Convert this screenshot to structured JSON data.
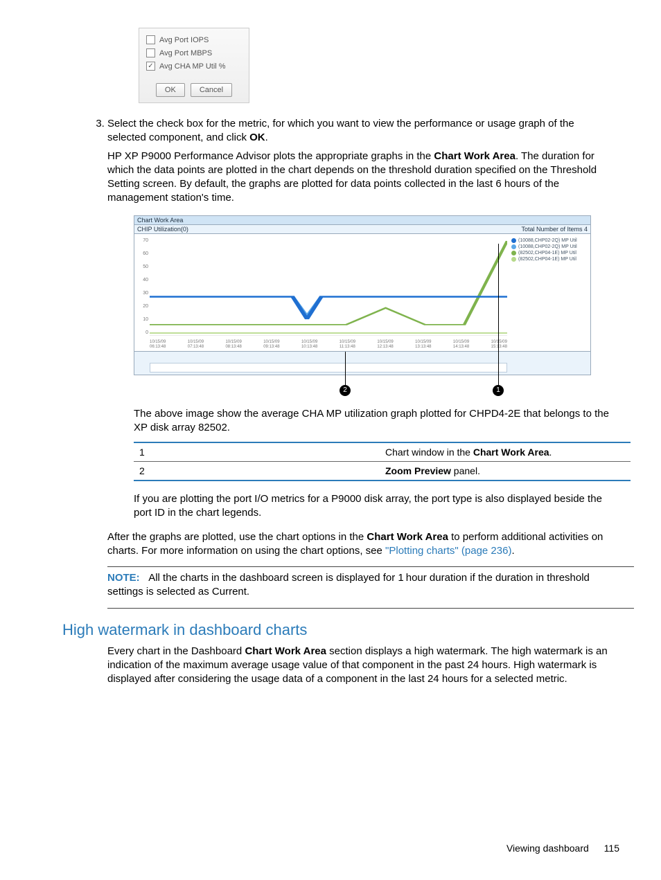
{
  "dialog": {
    "opts": [
      {
        "label": "Avg Port IOPS",
        "checked": false
      },
      {
        "label": "Avg Port MBPS",
        "checked": false
      },
      {
        "label": "Avg CHA MP Util %",
        "checked": true
      }
    ],
    "ok": "OK",
    "cancel": "Cancel"
  },
  "step3": {
    "num": "3.",
    "text_a": "Select the check box for the metric, for which you want to view the performance or usage graph of the selected component, and click ",
    "bold_ok": "OK",
    "text_b": ".",
    "p2_a": "HP XP P9000 Performance Advisor plots the appropriate graphs in the ",
    "p2_bold": "Chart Work Area",
    "p2_b": ". The duration for which the data points are plotted in the chart depends on the threshold duration specified on the Threshold Setting screen. By default, the graphs are plotted for data points collected in the last 6 hours of the management station's time."
  },
  "chart": {
    "titlebar": "Chart Work Area",
    "header_left": "CHIP Utilization(0)",
    "header_right": "Total Number of Items 4",
    "y_ticks": [
      "70",
      "60",
      "50",
      "40",
      "30",
      "20",
      "10",
      "0"
    ],
    "x_ticks": [
      {
        "d": "10/15/09",
        "t": "06:13:48"
      },
      {
        "d": "10/15/09",
        "t": "07:13:48"
      },
      {
        "d": "10/15/09",
        "t": "08:13:48"
      },
      {
        "d": "10/15/09",
        "t": "09:13:48"
      },
      {
        "d": "10/15/09",
        "t": "10:13:48"
      },
      {
        "d": "10/15/09",
        "t": "11:13:48"
      },
      {
        "d": "10/15/09",
        "t": "12:13:48"
      },
      {
        "d": "10/15/09",
        "t": "13:13:48"
      },
      {
        "d": "10/15/09",
        "t": "14:13:48"
      },
      {
        "d": "10/15/09",
        "t": "15:13:48"
      }
    ],
    "legend": [
      {
        "color": "#1f6fd1",
        "label": "(10088,CHP02-2Q) MP Util"
      },
      {
        "color": "#5da8e8",
        "label": "(10088,CHP02-2Q) MP Util"
      },
      {
        "color": "#7fb34d",
        "label": "(82502,CHP04-1E) MP Util"
      },
      {
        "color": "#b6d98a",
        "label": "(82502,CHP04-1E) MP Util"
      }
    ]
  },
  "chart_data": {
    "type": "line",
    "title": "CHIP Utilization(0)",
    "xlabel": "",
    "ylabel": "",
    "ylim": [
      0,
      70
    ],
    "x": [
      "06:13",
      "07:13",
      "08:13",
      "09:13",
      "10:13",
      "11:13",
      "12:13",
      "13:13",
      "14:13",
      "15:13"
    ],
    "series": [
      {
        "name": "(10088,CHP02-2Q) MP Util",
        "color": "#1f6fd1",
        "values": [
          28,
          28,
          28,
          28,
          12,
          28,
          28,
          28,
          28,
          28
        ]
      },
      {
        "name": "(10088,CHP02-2Q) MP Util",
        "color": "#5da8e8",
        "values": [
          28,
          28,
          28,
          28,
          14,
          28,
          28,
          28,
          28,
          28
        ]
      },
      {
        "name": "(82502,CHP04-1E) MP Util",
        "color": "#7fb34d",
        "values": [
          8,
          8,
          8,
          8,
          8,
          8,
          20,
          8,
          8,
          68
        ]
      },
      {
        "name": "(82502,CHP04-1E) MP Util",
        "color": "#b6d98a",
        "values": [
          2,
          2,
          2,
          2,
          2,
          2,
          2,
          2,
          2,
          2
        ]
      }
    ]
  },
  "callouts": {
    "c1": "1",
    "c2": "2"
  },
  "caption": "The above image show the average CHA MP utilization graph plotted for CHPD4-2E that belongs to the XP disk array 82502.",
  "table": {
    "r1_num": "1",
    "r1_a": "Chart window in the ",
    "r1_bold": "Chart Work Area",
    "r1_b": ".",
    "r2_num": "2",
    "r2_bold": "Zoom Preview",
    "r2_b": " panel."
  },
  "p_port": "If you are plotting the port I/O metrics for a P9000 disk array, the port type is also displayed beside the port ID in the chart legends.",
  "p_after_a": "After the graphs are plotted, use the chart options in the ",
  "p_after_bold": "Chart Work Area",
  "p_after_b": " to perform additional activities on charts. For more information on using the chart options, see ",
  "p_after_link": "\"Plotting charts\" (page 236)",
  "p_after_c": ".",
  "note_label": "NOTE:",
  "note_text": "All the charts in the dashboard screen is displayed for 1 hour duration if the duration in threshold settings is selected as Current.",
  "section_heading": "High watermark in dashboard charts",
  "section_p_a": "Every chart in the Dashboard ",
  "section_p_bold": "Chart Work Area",
  "section_p_b": " section displays a high watermark. The high watermark is an indication of the maximum average usage value of that component in the past 24 hours. High watermark is displayed after considering the usage data of a component in the last 24 hours for a selected metric.",
  "footer_text": "Viewing dashboard",
  "footer_page": "115"
}
